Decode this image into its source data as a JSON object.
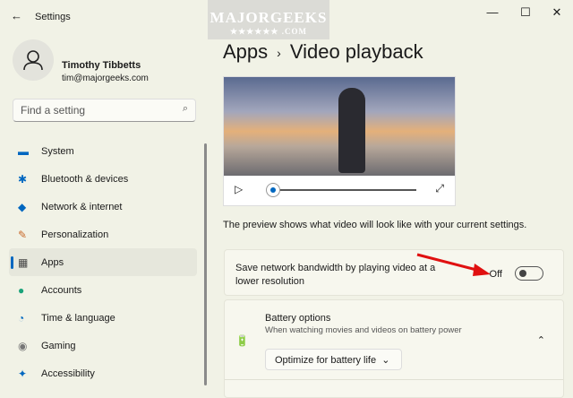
{
  "window": {
    "title": "Settings",
    "back": "←",
    "minimize": "—",
    "maximize": "☐",
    "close": "✕"
  },
  "watermark": {
    "line1": "MAJORGEEKS",
    "line2": "★★★★★★ .COM"
  },
  "user": {
    "name": "Timothy Tibbetts",
    "email": "tim@majorgeeks.com"
  },
  "search": {
    "placeholder": "Find a setting"
  },
  "nav": [
    {
      "label": "System",
      "icon": "▬"
    },
    {
      "label": "Bluetooth & devices",
      "icon": "✱"
    },
    {
      "label": "Network & internet",
      "icon": "◆"
    },
    {
      "label": "Personalization",
      "icon": "✎"
    },
    {
      "label": "Apps",
      "icon": "▦",
      "selected": true
    },
    {
      "label": "Accounts",
      "icon": "●"
    },
    {
      "label": "Time & language",
      "icon": "◔"
    },
    {
      "label": "Gaming",
      "icon": "◉"
    },
    {
      "label": "Accessibility",
      "icon": "✦"
    }
  ],
  "breadcrumb": {
    "parent": "Apps",
    "sep": "›",
    "current": "Video playback"
  },
  "video": {
    "play": "▷",
    "expand": "⤢",
    "progress": 0
  },
  "preview_desc": "The preview shows what video will look like with your current settings.",
  "bandwidth": {
    "label": "Save network bandwidth by playing video at a lower resolution",
    "state": "Off"
  },
  "battery": {
    "title": "Battery options",
    "subtitle": "When watching movies and videos on battery power",
    "selected": "Optimize for battery life",
    "chevron": "⌃",
    "dropdown_chevron": "⌄"
  }
}
